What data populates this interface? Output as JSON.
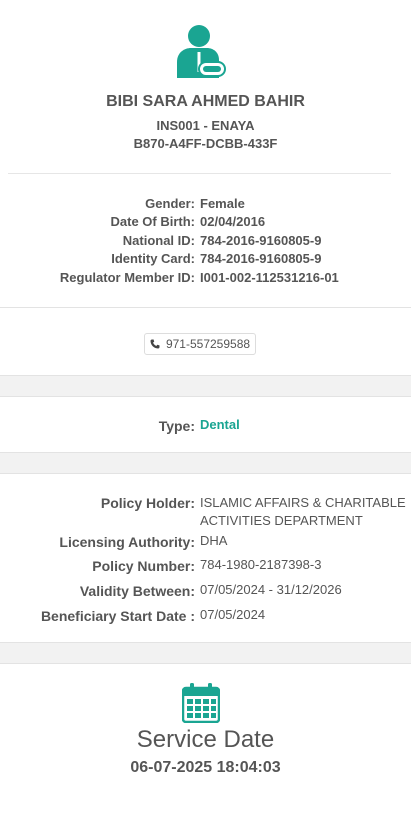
{
  "patient": {
    "name": "BIBI SARA AHMED BAHIR",
    "insurer_line": "INS001 - ENAYA",
    "card_id": "B870-A4FF-DCBB-433F"
  },
  "details": [
    {
      "label": "Gender:",
      "value": "Female"
    },
    {
      "label": "Date Of Birth:",
      "value": "02/04/2016"
    },
    {
      "label": "National ID:",
      "value": "784-2016-9160805-9"
    },
    {
      "label": "Identity Card:",
      "value": "784-2016-9160805-9"
    },
    {
      "label": "Regulator Member ID:",
      "value": "I001-002-112531216-01"
    }
  ],
  "contact": {
    "phone": "971-557259588"
  },
  "coverage": {
    "type_label": "Type:",
    "type_value": "Dental"
  },
  "policy": {
    "holder_label": "Policy Holder:",
    "holder_line1": "ISLAMIC AFFAIRS & CHARITABLE",
    "holder_line2": "ACTIVITIES DEPARTMENT",
    "authority_label": "Licensing Authority:",
    "authority_value": "DHA",
    "number_label": "Policy Number:",
    "number_value": "784-1980-2187398-3",
    "validity_label": "Validity Between:",
    "validity_value": "07/05/2024 - 31/12/2026",
    "start_label": "Beneficiary Start Date :",
    "start_value": "07/05/2024"
  },
  "service": {
    "label": "Service Date",
    "datetime": "06-07-2025 18:04:03"
  },
  "colors": {
    "accent": "#1aa592",
    "text": "#555555",
    "separator": "#f2f2f2"
  },
  "icons": [
    "patient-avatar-icon",
    "phone-icon",
    "calendar-icon"
  ]
}
